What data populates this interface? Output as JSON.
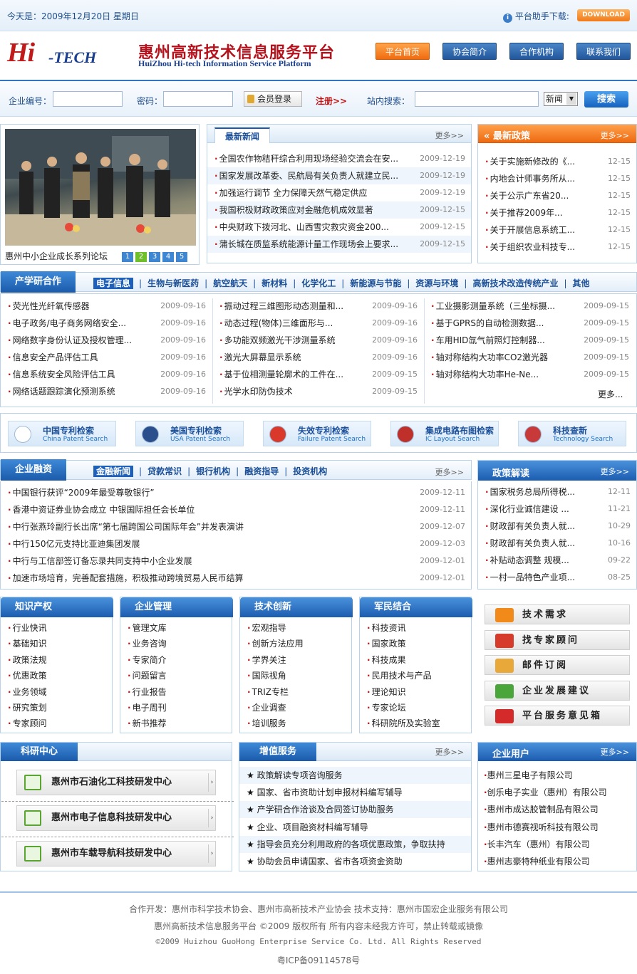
{
  "topbar": {
    "date": "今天是：2009年12月20日 星期日",
    "helper": "平台助手下载:",
    "download_label": "DOWNLOAD"
  },
  "header": {
    "logo_hi": "Hi",
    "logo_tech": "-TECH",
    "title": "惠州高新技术信息服务平台",
    "subtitle": "HuiZhou Hi-tech Information Service Platform",
    "nav": [
      "平台首页",
      "协会简介",
      "合作机构",
      "联系我们"
    ]
  },
  "login": {
    "company_label": "企业编号：",
    "password_label": "密码：",
    "member_btn": "会员登录",
    "register": "注册>>",
    "search_label": "站内搜索：",
    "select_value": "新闻",
    "search_btn": "搜索"
  },
  "photo": {
    "caption": "惠州中小企业成长系列论坛",
    "pages": [
      "1",
      "2",
      "3",
      "4",
      "5"
    ]
  },
  "news": {
    "tab": "最新新闻",
    "more": "更多>>",
    "items": [
      {
        "t": "全国农作物秸秆综合利用现场经验交流会在安...",
        "d": "2009-12-19"
      },
      {
        "t": "国家发展改革委、民航局有关负责人就建立民...",
        "d": "2009-12-19"
      },
      {
        "t": "加强运行调节 全力保障天然气稳定供应",
        "d": "2009-12-19"
      },
      {
        "t": "我国积极财政政策应对金融危机成效显著",
        "d": "2009-12-15"
      },
      {
        "t": "中央财政下拨河北、山西雪灾救灾资金200...",
        "d": "2009-12-15"
      },
      {
        "t": "蒲长城在质监系统能源计量工作现场会上要求...",
        "d": "2009-12-15"
      }
    ]
  },
  "policy": {
    "tab": "最新政策",
    "more": "更多>>",
    "items": [
      {
        "t": "关于实施新修改的《...",
        "d": "12-15"
      },
      {
        "t": "内地会计师事务所从...",
        "d": "12-15"
      },
      {
        "t": "关于公示广东省20...",
        "d": "12-15"
      },
      {
        "t": "关于推荐2009年...",
        "d": "12-15"
      },
      {
        "t": "关于开展信息系统工...",
        "d": "12-15"
      },
      {
        "t": "关于组织农业科技专...",
        "d": "12-15"
      }
    ]
  },
  "cxy": {
    "title": "产学研合作",
    "tabs": [
      "电子信息",
      "生物与新医药",
      "航空航天",
      "新材料",
      "化学化工",
      "新能源与节能",
      "资源与环境",
      "高新技术改造传统产业",
      "其他"
    ],
    "col1": [
      {
        "t": "荧光性光纤氧传感器",
        "d": "2009-09-16"
      },
      {
        "t": "电子政务/电子商务网络安全...",
        "d": "2009-09-16"
      },
      {
        "t": "网络数字身份认证及授权管理...",
        "d": "2009-09-16"
      },
      {
        "t": "信息安全产品评估工具",
        "d": "2009-09-16"
      },
      {
        "t": "信息系统安全风险评估工具",
        "d": "2009-09-16"
      },
      {
        "t": "网络话题跟踪演化预测系统",
        "d": "2009-09-16"
      }
    ],
    "col2": [
      {
        "t": "振动过程三维图形动态测量和...",
        "d": "2009-09-16"
      },
      {
        "t": "动态过程(物体)三维面形与...",
        "d": "2009-09-16"
      },
      {
        "t": "多功能双频激光干涉测量系统",
        "d": "2009-09-16"
      },
      {
        "t": "激光大屏幕显示系统",
        "d": "2009-09-16"
      },
      {
        "t": "基于位相测量轮廓术的工件在...",
        "d": "2009-09-15"
      },
      {
        "t": "光学水印防伪技术",
        "d": "2009-09-15"
      }
    ],
    "col3": [
      {
        "t": "工业摄影测量系统（三坐标摄...",
        "d": "2009-09-15"
      },
      {
        "t": "基于GPRS的自动检测数据...",
        "d": "2009-09-15"
      },
      {
        "t": "车用HID氙气前照灯控制器...",
        "d": "2009-09-15"
      },
      {
        "t": "轴对称结构大功率CO2激光器",
        "d": "2009-09-15"
      },
      {
        "t": "轴对称结构大功率He-Ne...",
        "d": "2009-09-15"
      }
    ],
    "more": "更多..."
  },
  "searches": [
    {
      "cn": "中国专利检索",
      "en": "China Patent Search",
      "color": "#ffffff"
    },
    {
      "cn": "美国专利检索",
      "en": "USA Patent Search",
      "color": "#2a4f8c"
    },
    {
      "cn": "失效专利检索",
      "en": "Failure Patent Search",
      "color": "#d9382a"
    },
    {
      "cn": "集成电路布图检索",
      "en": "IC Layout Search",
      "color": "#c0302a"
    },
    {
      "cn": "科技查新",
      "en": "Technology Search",
      "color": "#c83a3a"
    }
  ],
  "finance": {
    "title": "企业融资",
    "tabs": [
      "金融新闻",
      "贷款常识",
      "银行机构",
      "融资指导",
      "投资机构"
    ],
    "more": "更多>>",
    "items": [
      {
        "t": "中国银行获评“2009年最受尊敬银行”",
        "d": "2009-12-11"
      },
      {
        "t": "香港中资证券业协会成立 中银国际担任会长单位",
        "d": "2009-12-11"
      },
      {
        "t": "中行张燕玲副行长出席“第七届跨国公司国际年会”并发表演讲",
        "d": "2009-12-07"
      },
      {
        "t": "中行150亿元支持比亚迪集团发展",
        "d": "2009-12-03"
      },
      {
        "t": "中行与工信部签订备忘录共同支持中小企业发展",
        "d": "2009-12-01"
      },
      {
        "t": "加速市场培育，完善配套措施，积极推动跨境贸易人民币结算",
        "d": "2009-12-01"
      }
    ]
  },
  "policyread": {
    "title": "政策解读",
    "more": "更多>>",
    "items": [
      {
        "t": "国家税务总局所得税...",
        "d": "12-11"
      },
      {
        "t": "深化行业诚信建设 ...",
        "d": "11-21"
      },
      {
        "t": "财政部有关负责人就...",
        "d": "10-29"
      },
      {
        "t": "财政部有关负责人就...",
        "d": "10-16"
      },
      {
        "t": "补贴动态调整 规模...",
        "d": "09-22"
      },
      {
        "t": "一村一品特色产业项...",
        "d": "08-25"
      }
    ]
  },
  "cols": [
    {
      "title": "知识产权",
      "items": [
        "行业快讯",
        "基础知识",
        "政策法规",
        "优惠政策",
        "业务领域",
        "研究策划",
        "专家顾问"
      ]
    },
    {
      "title": "企业管理",
      "items": [
        "管理文库",
        "业务咨询",
        "专家简介",
        "问题留言",
        "行业报告",
        "电子周刊",
        "新书推荐"
      ]
    },
    {
      "title": "技术创新",
      "items": [
        "宏观指导",
        "创新方法应用",
        "学界关注",
        "国际视角",
        "TRIZ专栏",
        "企业调查",
        "培训服务"
      ]
    },
    {
      "title": "军民结合",
      "items": [
        "科技资讯",
        "国家政策",
        "科技成果",
        "民用技术与产品",
        "理论知识",
        "专家论坛",
        "科研院所及实验室"
      ]
    }
  ],
  "rbtns": [
    {
      "label": "技术需求",
      "icon": "rss-icon",
      "color": "#f28a1a"
    },
    {
      "label": "找专家顾问",
      "icon": "expert-icon",
      "color": "#d63a2a"
    },
    {
      "label": "邮件订阅",
      "icon": "mail-icon",
      "color": "#e9a83a"
    },
    {
      "label": "企业发展建议",
      "icon": "chat-icon",
      "color": "#4aa63a"
    },
    {
      "label": "平台服务意见箱",
      "icon": "mailbox-icon",
      "color": "#d42a2a"
    }
  ],
  "research": {
    "title": "科研中心",
    "items": [
      "惠州市石油化工科技研发中心",
      "惠州市电子信息科技研发中心",
      "惠州市车载导航科技研发中心"
    ]
  },
  "services": {
    "title": "增值服务",
    "more": "更多>>",
    "items": [
      "政策解读专项咨询服务",
      "国家、省市资助计划申报材料编写辅导",
      "产学研合作洽谈及合同签订协助服务",
      "企业、项目融资材料编写辅导",
      "指导会员充分利用政府的各项优惠政策，争取扶持",
      "协助会员申请国家、省市各项资金资助"
    ]
  },
  "users": {
    "title": "企业用户",
    "more": "更多>>",
    "items": [
      "惠州三星电子有限公司",
      "创乐电子实业（惠州）有限公司",
      "惠州市成达胶管制品有限公司",
      "惠州市德赛视听科技有限公司",
      "长丰汽车（惠州）有限公司",
      "惠州志豪特种纸业有限公司"
    ]
  },
  "footer": {
    "l1": "合作开发：惠州市科学技术协会、惠州市高新技术产业协会 技术支持：惠州市国宏企业服务有限公司",
    "l2": "惠州高新技术信息服务平台 ©2009 版权所有 所有内容未经我方许可，禁止转载或镜像",
    "l3": "©2009 Huizhou GuoHong Enterprise Service Co. Ltd. All Rights Reserved",
    "l4": "粤ICP备09114578号"
  }
}
